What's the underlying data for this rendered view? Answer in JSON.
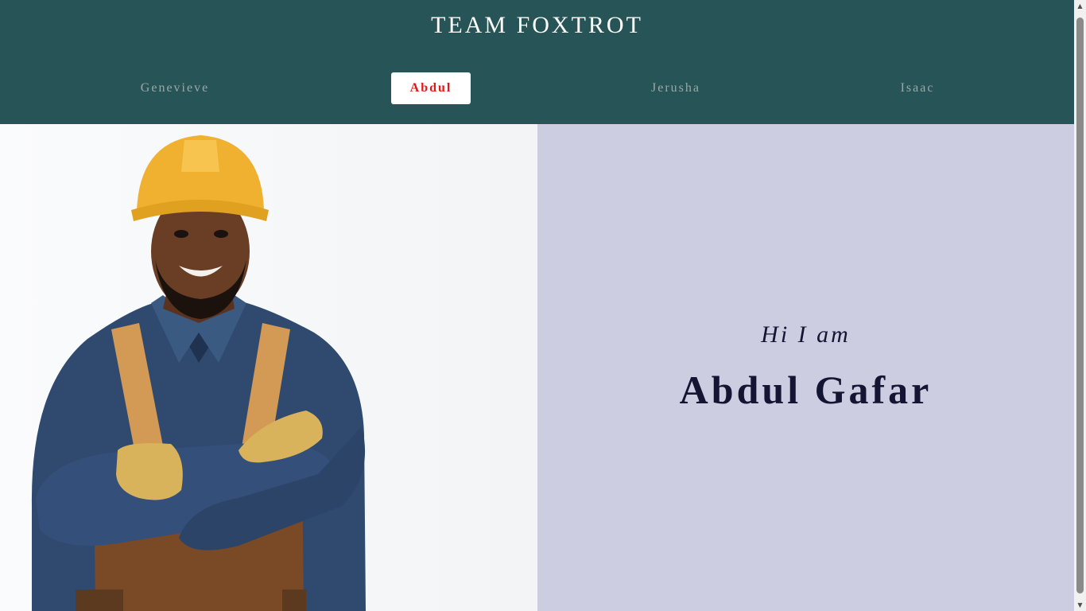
{
  "header": {
    "title": "TEAM FOXTROT",
    "background": "#275557"
  },
  "nav": {
    "items": [
      {
        "label": "Genevieve",
        "active": false
      },
      {
        "label": "Abdul",
        "active": true
      },
      {
        "label": "Jerusha",
        "active": false
      },
      {
        "label": "Isaac",
        "active": false
      }
    ],
    "active_color": "#e01a1a"
  },
  "profile": {
    "greeting": "Hi I am",
    "name": "Abdul Gafar",
    "panel_color": "#cdcde2"
  },
  "photo": {
    "subject": "smiling worker in yellow hard hat, denim shirt, overalls and gloves with arms crossed"
  },
  "icons": {
    "scroll_up": "scroll-up-arrow-icon",
    "scroll_down": "scroll-down-arrow-icon"
  }
}
